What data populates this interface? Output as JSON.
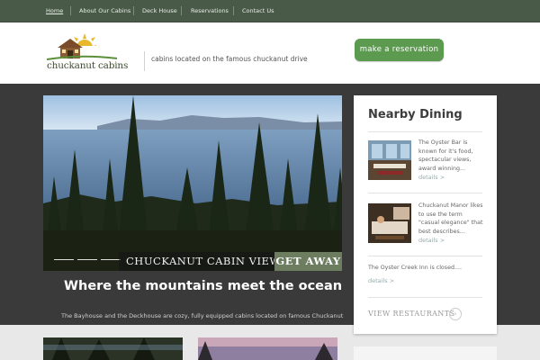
{
  "nav": {
    "items": [
      {
        "label": "Home",
        "active": true
      },
      {
        "label": "About Our Cabins",
        "active": false
      },
      {
        "label": "Deck House",
        "active": false
      },
      {
        "label": "Reservations",
        "active": false
      },
      {
        "label": "Contact Us",
        "active": false
      }
    ]
  },
  "header": {
    "logo_text": "chuckanut cabins",
    "tagline": "cabins located on the famous chuckanut drive",
    "reserve_button": "make a reservation"
  },
  "slider": {
    "caption": "CHUCKANUT CABIN VIEWS",
    "cta": "GET AWAY"
  },
  "main": {
    "headline": "Where the mountains meet the ocean",
    "intro": "The Bayhouse and the Deckhouse are cozy, fully equipped cabins located on famous Chuckanut"
  },
  "sidebar": {
    "title": "Nearby Dining",
    "items": [
      {
        "text": "The Oyster Bar is known for it's food, spectacular views, award winning...",
        "link": "details >"
      },
      {
        "text": "Chuckanut Manor likes to use the term \"casual elegance\" that best describes...",
        "link": "details >"
      }
    ],
    "oyster_creek": {
      "text": "The Oyster Creek Inn is closed....",
      "link": "details >"
    },
    "view_all": "VIEW RESTAURANTS",
    "arrow": "›"
  },
  "colors": {
    "nav_bg": "#4a5a49",
    "button_green": "#5c9a50",
    "dark_band": "#3a3a3a",
    "caption_green": "#6c7d60"
  }
}
